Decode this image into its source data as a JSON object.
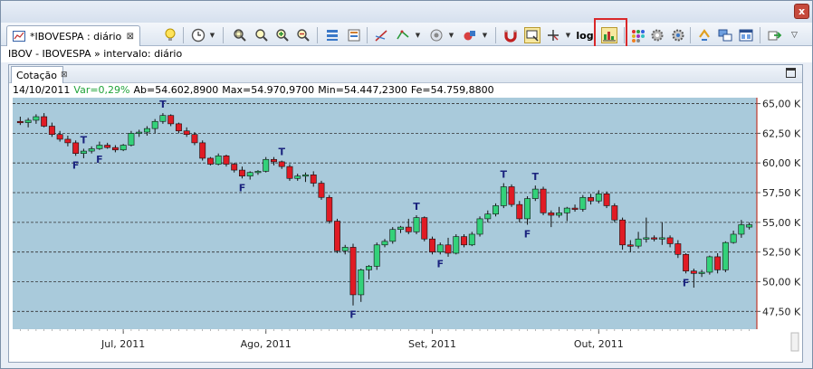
{
  "window": {
    "close_label": "x"
  },
  "document_tab": {
    "label": "*IBOVESPA : diário",
    "close_label": "⊠"
  },
  "toolbar": {
    "icons": [
      "lightbulb-icon",
      "clock-icon",
      "zoom-fit-icon",
      "zoom-icon",
      "zoom-in-icon",
      "zoom-out-icon",
      "add-study-icon",
      "template-icon",
      "drawing-tools-icon",
      "lines-icon",
      "sheet-icon",
      "objects-icon",
      "magnet-icon",
      "crosshair-toggle-icon",
      "cursor-icon",
      "log-scale-icon",
      "volume-scale-icon",
      "palette-icon",
      "settings-icon",
      "properties-icon",
      "sync-icon",
      "windows-icon",
      "layout-icon",
      "export-icon"
    ],
    "log_label": "log",
    "highlighted_icon": "volume-scale-icon"
  },
  "breadcrumb": "IBOV - IBOVESPA » intervalo: diário",
  "panel": {
    "tab_label": "Cotação",
    "tab_close": "⊠"
  },
  "quote_info": {
    "date": "14/10/2011",
    "var": "Var=0,29%",
    "var_color": "#21a33a",
    "open": "Ab=54.602,8900",
    "max": "Max=54.970,9700",
    "min": "Min=54.447,2300",
    "close": "Fe=54.759,8800"
  },
  "chart_data": {
    "type": "candlestick",
    "y_axis": {
      "ticks": [
        47500,
        50000,
        52500,
        55000,
        57500,
        60000,
        62500,
        65000
      ],
      "tick_labels": [
        "47,50 K",
        "50,00 K",
        "52,50 K",
        "55,00 K",
        "57,50 K",
        "60,00 K",
        "62,50 K",
        "65,00 K"
      ],
      "range": [
        46000,
        65500
      ]
    },
    "x_axis_labels": [
      {
        "label": "Jul, 2011",
        "index": 13
      },
      {
        "label": "Ago, 2011",
        "index": 31
      },
      {
        "label": "Set, 2011",
        "index": 52
      },
      {
        "label": "Out, 2011",
        "index": 73
      }
    ],
    "up_color": "#33d17a",
    "down_color": "#e01b24",
    "background": "#a9cadb",
    "candles": [
      [
        63500,
        63900,
        63200,
        63400
      ],
      [
        63400,
        63800,
        63000,
        63600
      ],
      [
        63600,
        64100,
        63300,
        63900
      ],
      [
        63900,
        64200,
        63000,
        63100
      ],
      [
        63100,
        63400,
        62200,
        62400
      ],
      [
        62400,
        62700,
        61800,
        62000
      ],
      [
        62000,
        62300,
        61400,
        61700
      ],
      [
        61700,
        61900,
        60600,
        60800
      ],
      [
        60800,
        61200,
        60400,
        61000
      ],
      [
        61000,
        61400,
        60800,
        61200
      ],
      [
        61200,
        61800,
        61100,
        61500
      ],
      [
        61500,
        61700,
        61200,
        61300
      ],
      [
        61300,
        61500,
        60900,
        61100
      ],
      [
        61100,
        61600,
        61000,
        61500
      ],
      [
        61500,
        62700,
        61400,
        62500
      ],
      [
        62500,
        62800,
        62200,
        62600
      ],
      [
        62600,
        63100,
        62300,
        62900
      ],
      [
        62900,
        63700,
        62500,
        63500
      ],
      [
        63500,
        64200,
        63300,
        64000
      ],
      [
        64000,
        64100,
        63100,
        63300
      ],
      [
        63300,
        63400,
        62500,
        62700
      ],
      [
        62700,
        63000,
        62200,
        62400
      ],
      [
        62400,
        62600,
        61500,
        61700
      ],
      [
        61700,
        61900,
        60200,
        60400
      ],
      [
        60400,
        60500,
        59800,
        59900
      ],
      [
        59900,
        60800,
        59800,
        60600
      ],
      [
        60600,
        60700,
        59700,
        59900
      ],
      [
        59900,
        60000,
        59200,
        59400
      ],
      [
        59400,
        59700,
        58700,
        58900
      ],
      [
        58900,
        59300,
        58600,
        59200
      ],
      [
        59200,
        59400,
        59000,
        59300
      ],
      [
        59300,
        60500,
        59200,
        60300
      ],
      [
        60300,
        60500,
        59800,
        60100
      ],
      [
        60100,
        60200,
        59500,
        59700
      ],
      [
        59700,
        59900,
        58500,
        58700
      ],
      [
        58700,
        59100,
        58500,
        58900
      ],
      [
        58900,
        59200,
        58400,
        59000
      ],
      [
        59000,
        59300,
        58000,
        58300
      ],
      [
        58300,
        58500,
        56900,
        57100
      ],
      [
        57100,
        57300,
        54900,
        55100
      ],
      [
        55100,
        55300,
        52400,
        52600
      ],
      [
        52600,
        53100,
        52300,
        52900
      ],
      [
        52900,
        53200,
        48000,
        48900
      ],
      [
        48900,
        51100,
        48300,
        51000
      ],
      [
        51000,
        51400,
        50200,
        51300
      ],
      [
        51300,
        53300,
        51000,
        53100
      ],
      [
        53100,
        53600,
        52900,
        53400
      ],
      [
        53400,
        54600,
        53200,
        54400
      ],
      [
        54400,
        54700,
        54100,
        54600
      ],
      [
        54600,
        55300,
        54000,
        54200
      ],
      [
        54200,
        55600,
        54000,
        55400
      ],
      [
        55400,
        55500,
        53400,
        53600
      ],
      [
        53600,
        53800,
        52300,
        52500
      ],
      [
        52500,
        53300,
        52300,
        53100
      ],
      [
        53100,
        53700,
        52100,
        52400
      ],
      [
        52400,
        54000,
        52300,
        53800
      ],
      [
        53800,
        54000,
        52900,
        53100
      ],
      [
        53100,
        54200,
        53000,
        54000
      ],
      [
        54000,
        55500,
        53800,
        55300
      ],
      [
        55300,
        56000,
        55000,
        55700
      ],
      [
        55700,
        56600,
        55500,
        56400
      ],
      [
        56400,
        58300,
        56200,
        58000
      ],
      [
        58000,
        58200,
        56300,
        56500
      ],
      [
        56500,
        56800,
        55000,
        55300
      ],
      [
        55300,
        57200,
        54800,
        57000
      ],
      [
        57000,
        58100,
        56800,
        57800
      ],
      [
        57800,
        58000,
        55600,
        55800
      ],
      [
        55800,
        56000,
        54600,
        55600
      ],
      [
        55600,
        56300,
        55400,
        55800
      ],
      [
        55800,
        56300,
        55100,
        56200
      ],
      [
        56200,
        56500,
        55900,
        56100
      ],
      [
        56100,
        57300,
        55900,
        57100
      ],
      [
        57100,
        57400,
        56500,
        56800
      ],
      [
        56800,
        57700,
        56600,
        57400
      ],
      [
        57400,
        57600,
        56200,
        56400
      ],
      [
        56400,
        56600,
        55000,
        55200
      ],
      [
        55200,
        55400,
        52700,
        53100
      ],
      [
        53100,
        53500,
        52500,
        53000
      ],
      [
        53000,
        54200,
        52800,
        53600
      ],
      [
        53600,
        55400,
        53300,
        53700
      ],
      [
        53700,
        53900,
        53400,
        53600
      ],
      [
        53600,
        55000,
        53100,
        53700
      ],
      [
        53700,
        53900,
        52900,
        53200
      ],
      [
        53200,
        53500,
        52000,
        52300
      ],
      [
        52300,
        52400,
        50700,
        50900
      ],
      [
        50900,
        51100,
        49500,
        50700
      ],
      [
        50700,
        51000,
        50400,
        50800
      ],
      [
        50800,
        52200,
        50600,
        52100
      ],
      [
        52100,
        52400,
        50700,
        51000
      ],
      [
        51000,
        53400,
        50800,
        53300
      ],
      [
        53300,
        54300,
        53200,
        54000
      ],
      [
        54000,
        55200,
        53700,
        54800
      ],
      [
        54600,
        55000,
        54400,
        54800
      ]
    ],
    "markers": [
      {
        "label": "T",
        "index": 8,
        "type": "top"
      },
      {
        "label": "F",
        "index": 7,
        "type": "bottom"
      },
      {
        "label": "F",
        "index": 10,
        "type": "bottom"
      },
      {
        "label": "T",
        "index": 18,
        "type": "top"
      },
      {
        "label": "T",
        "index": 33,
        "type": "top"
      },
      {
        "label": "F",
        "index": 28,
        "type": "bottom"
      },
      {
        "label": "F",
        "index": 42,
        "type": "bottom"
      },
      {
        "label": "T",
        "index": 50,
        "type": "top"
      },
      {
        "label": "F",
        "index": 53,
        "type": "bottom"
      },
      {
        "label": "T",
        "index": 61,
        "type": "top"
      },
      {
        "label": "T",
        "index": 65,
        "type": "top"
      },
      {
        "label": "F",
        "index": 64,
        "type": "bottom"
      },
      {
        "label": "F",
        "index": 84,
        "type": "bottom"
      }
    ]
  }
}
